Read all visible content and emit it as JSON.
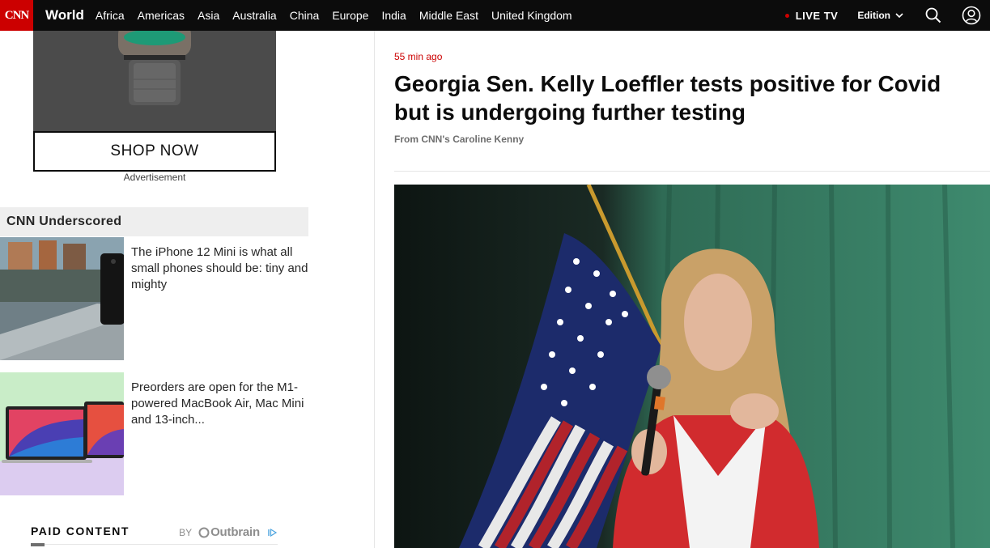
{
  "nav": {
    "logo_text": "CNN",
    "section": "World",
    "links": [
      "Africa",
      "Americas",
      "Asia",
      "Australia",
      "China",
      "Europe",
      "India",
      "Middle East",
      "United Kingdom"
    ],
    "live_tv": "LIVE TV",
    "edition": "Edition",
    "icons": [
      "chevron-down-icon",
      "search-icon",
      "account-icon"
    ]
  },
  "ad": {
    "shop_label": "SHOP NOW",
    "ad_label": "Advertisement"
  },
  "underscored": {
    "heading": "CNN Underscored",
    "items": [
      {
        "text": "The iPhone 12 Mini is what all small phones should be: tiny and mighty"
      },
      {
        "text": "Preorders are open for the M1-powered MacBook Air, Mac Mini and 13-inch..."
      }
    ]
  },
  "paid": {
    "label": "PAID CONTENT",
    "by": "BY",
    "provider": "Outbrain"
  },
  "article": {
    "timestamp": "55 min ago",
    "headline": "Georgia Sen. Kelly Loeffler tests positive for Covid but is undergoing further testing",
    "byline": "From CNN's Caroline Kenny"
  },
  "colors": {
    "brand_red": "#cc0000",
    "nav_bg": "#0c0c0c",
    "section_bg": "#eeeeee"
  }
}
